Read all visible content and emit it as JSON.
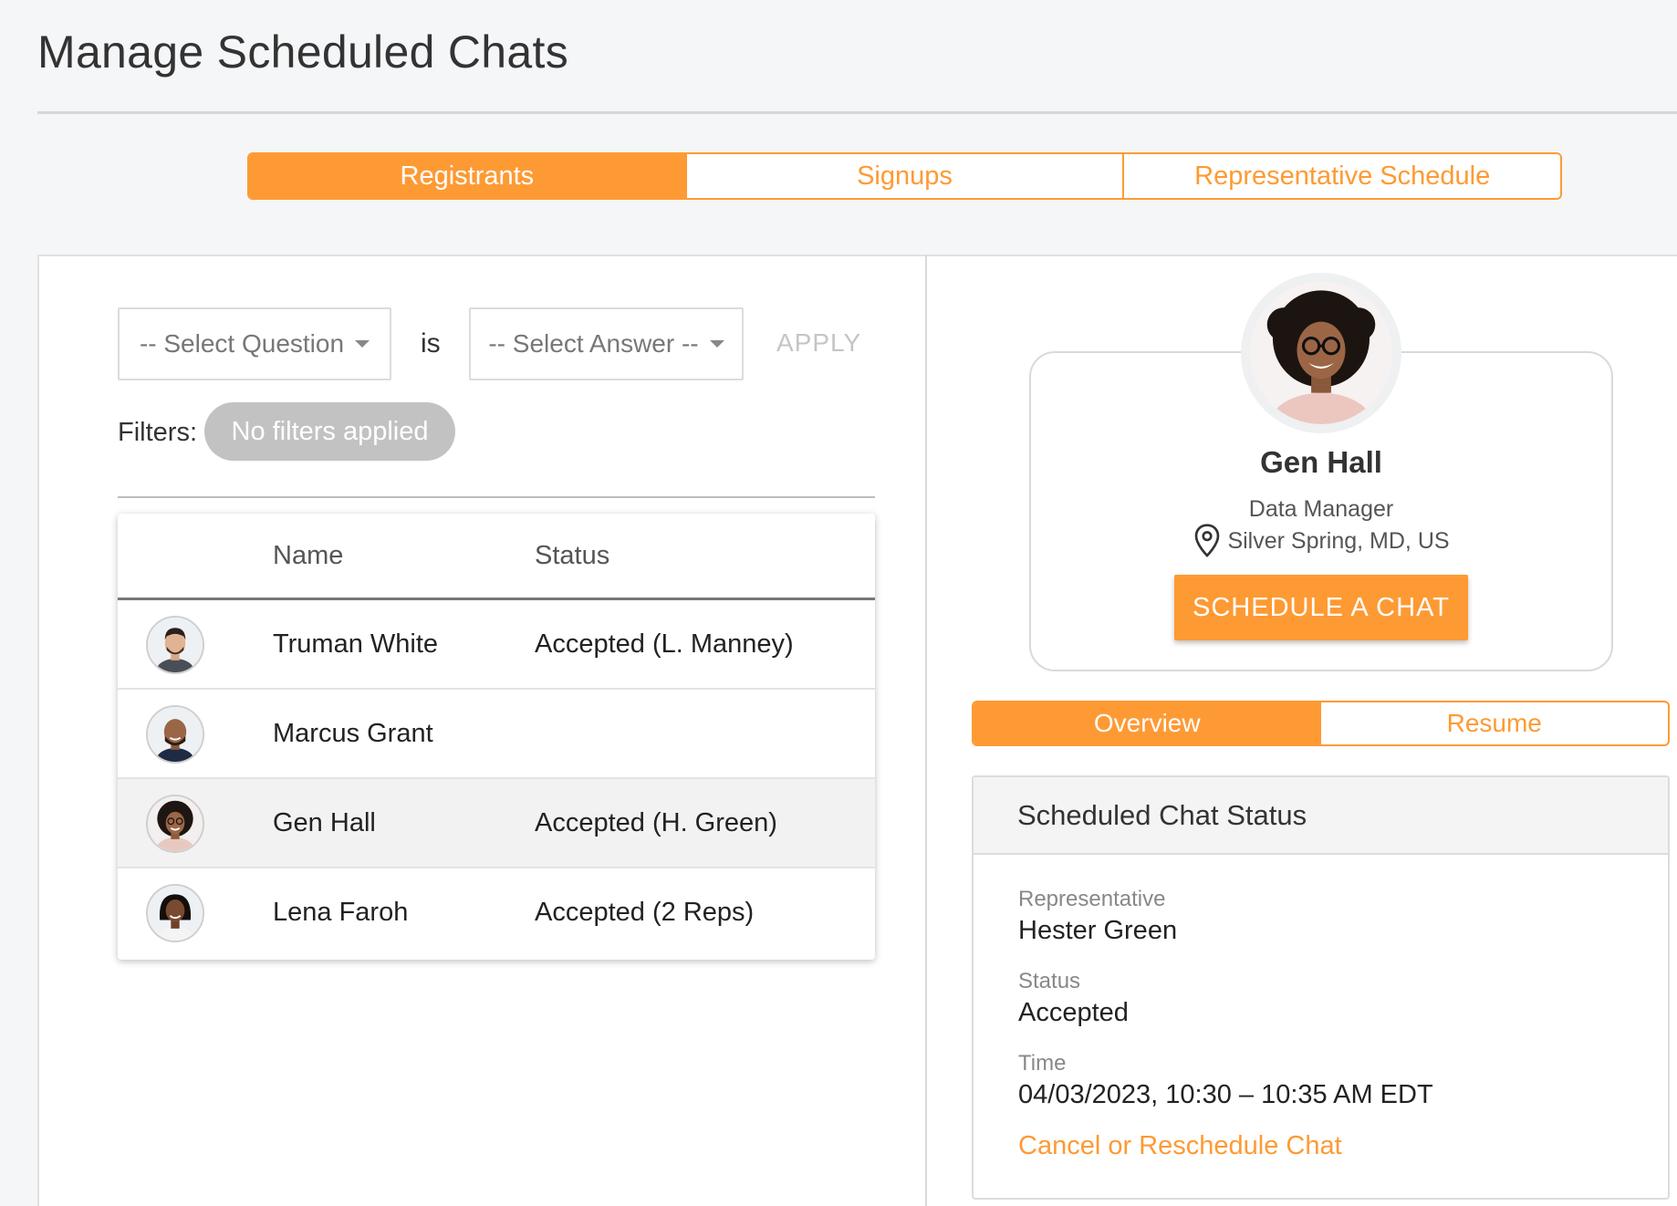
{
  "page": {
    "title": "Manage Scheduled Chats"
  },
  "top_tabs": [
    {
      "label": "Registrants",
      "active": true
    },
    {
      "label": "Signups",
      "active": false
    },
    {
      "label": "Representative Schedule",
      "active": false
    }
  ],
  "filters": {
    "question_placeholder": "-- Select Question",
    "connector": "is",
    "answer_placeholder": "-- Select Answer --",
    "apply_label": "APPLY",
    "filters_label": "Filters:",
    "pill_label": "No filters applied"
  },
  "table": {
    "headers": {
      "name": "Name",
      "status": "Status"
    },
    "rows": [
      {
        "name": "Truman White",
        "status": "Accepted (L. Manney)",
        "selected": false
      },
      {
        "name": "Marcus Grant",
        "status": "",
        "selected": false
      },
      {
        "name": "Gen Hall",
        "status": "Accepted (H. Green)",
        "selected": true
      },
      {
        "name": "Lena Faroh",
        "status": "Accepted (2 Reps)",
        "selected": false
      }
    ]
  },
  "profile": {
    "name": "Gen Hall",
    "role": "Data Manager",
    "location": "Silver Spring, MD, US",
    "cta": "SCHEDULE A CHAT"
  },
  "detail_tabs": [
    {
      "label": "Overview",
      "active": true
    },
    {
      "label": "Resume",
      "active": false
    }
  ],
  "status_card": {
    "title": "Scheduled Chat Status",
    "rep_label": "Representative",
    "rep_value": "Hester Green",
    "status_label": "Status",
    "status_value": "Accepted",
    "time_label": "Time",
    "time_value": "04/03/2023, 10:30 – 10:35 AM EDT",
    "action": "Cancel or Reschedule Chat"
  },
  "colors": {
    "accent": "#fe9a34",
    "pill": "#c2c2c2",
    "muted": "#888888"
  }
}
